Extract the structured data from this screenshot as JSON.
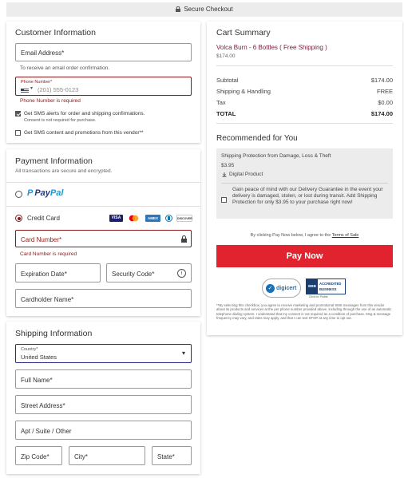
{
  "topbar": {
    "title": "Secure Checkout",
    "icon": "lock-icon"
  },
  "customer": {
    "heading": "Customer Information",
    "email": {
      "label": "Email Address*",
      "note": "To receive an email order confirmation."
    },
    "phone": {
      "small_label": "Phone Number*",
      "placeholder": "(201) 555-0123",
      "country_flag": "us-flag-icon",
      "error": "Phone Number is required"
    },
    "sms_alerts": {
      "label": "Get SMS alerts for order and shipping confirmations.",
      "note": "Consent is not required for purchase.",
      "checked": true
    },
    "sms_promos": {
      "label": "Get SMS content and promotions from this vendor**",
      "checked": false
    }
  },
  "payment": {
    "heading": "Payment Information",
    "subtitle": "All transactions are secure and encrypted.",
    "paypal": {
      "label_pay": "Pay",
      "label_pal": "Pal",
      "selected": false
    },
    "credit": {
      "label": "Credit Card",
      "selected": true,
      "brands": [
        "VISA",
        "",
        "AMEX",
        "",
        "DISCOVER"
      ]
    },
    "card_number": {
      "label": "Card Number*",
      "error": "Card Number is required"
    },
    "expiration": {
      "label": "Expiration Date*"
    },
    "security": {
      "label": "Security Code*"
    },
    "cardholder": {
      "label": "Cardholder Name*"
    }
  },
  "shipping": {
    "heading": "Shipping Information",
    "country": {
      "small_label": "Country*",
      "value": "United States"
    },
    "full_name": "Full Name*",
    "street": "Street Address*",
    "apt": "Apt / Suite / Other",
    "zip": "Zip Code*",
    "city": "City*",
    "state": "State*"
  },
  "cart": {
    "heading": "Cart Summary",
    "product_name": "Volca Burn - 6 Bottles ( Free Shipping )",
    "product_price": "$174.00",
    "rows": [
      {
        "label": "Subtotal",
        "value": "$174.00"
      },
      {
        "label": "Shipping & Handling",
        "value": "FREE"
      },
      {
        "label": "Tax",
        "value": "$0.00"
      },
      {
        "label": "TOTAL",
        "value": "$174.00"
      }
    ],
    "recommended": {
      "heading": "Recommended for You",
      "title": "Shipping Protection from Damage, Loss & Theft",
      "price": "$3.95",
      "tag": "Digital Product",
      "desc": "Gain peace of mind with our Delivery Guarantee in the event your delivery is damaged, stolen, or lost during transit. Add Shipping Protection for only $3.95 to your purchase right now!"
    },
    "terms_prefix": "By clicking Pay Now below, I agree to the ",
    "terms_link": "Terms of Sale",
    "pay_button": "Pay Now",
    "digicert": "digicert",
    "bbb_line1": "ACCREDITED",
    "bbb_line2": "BUSINESS",
    "bbb_note": "Click for Profile",
    "fine_print": "**By selecting this checkbox, you agree to receive marketing and promotional SMS messages from this vendor about its products and services at the per phone number provided above, including through the use of an automatic telephone dialing system. I understand that my consent is not required as a condition of purchase. Msg & message frequency may vary, and rates may apply, and that I can text STOP at any time to opt out."
  },
  "colors": {
    "accent": "#e0232e",
    "error": "#8b1a1a",
    "paypal_dark": "#253b80",
    "paypal_light": "#179bd7"
  }
}
